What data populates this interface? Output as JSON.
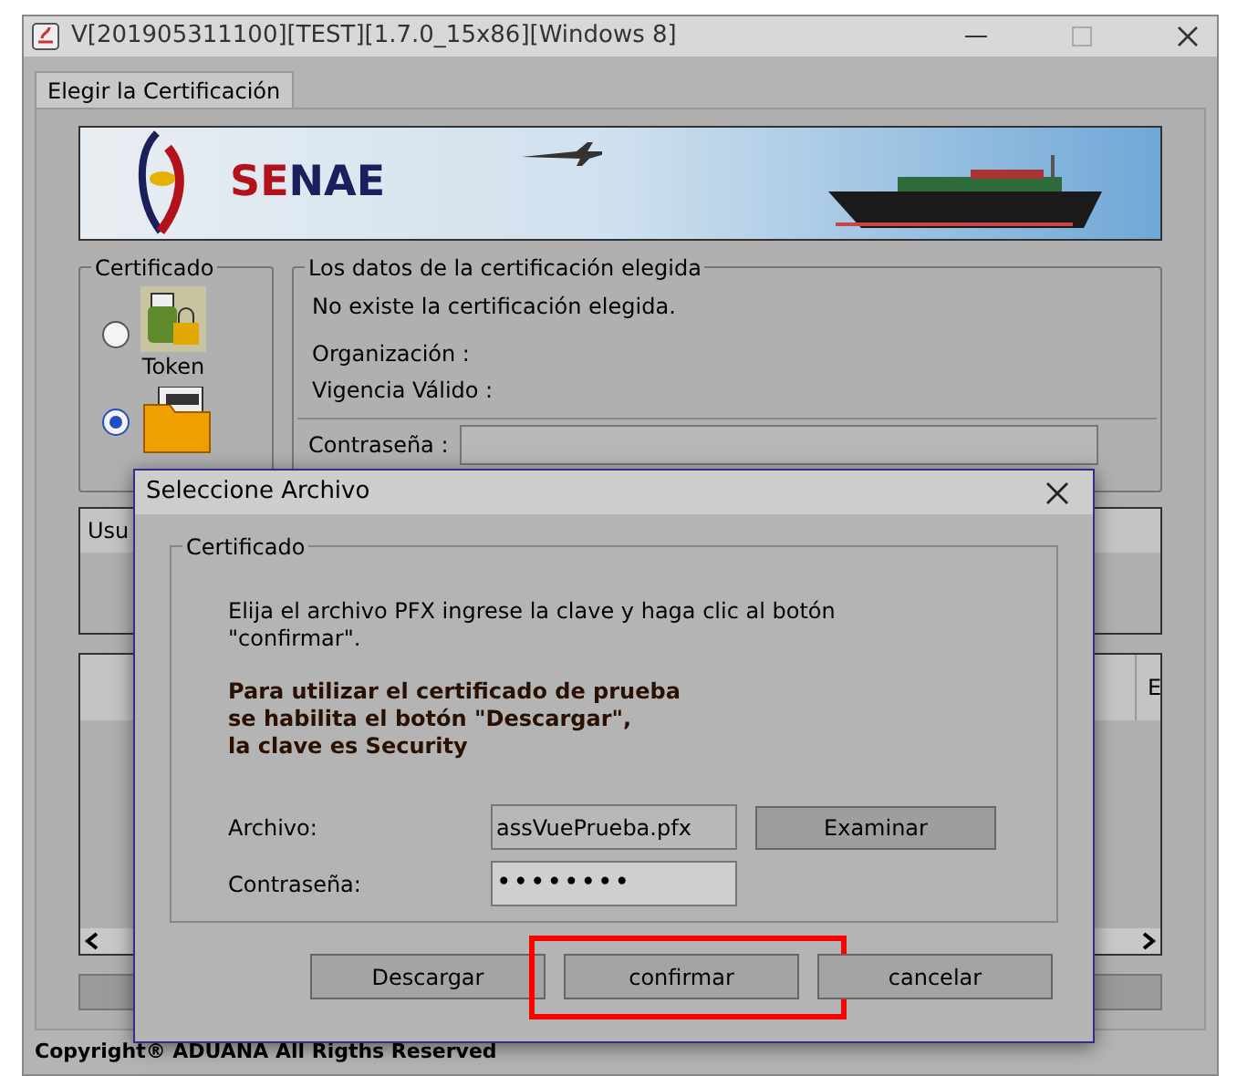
{
  "window": {
    "title": "V[201905311100][TEST][1.7.0_15x86][Windows 8]"
  },
  "tabs": [
    {
      "label": "Elegir la Certificación",
      "selected": true
    }
  ],
  "banner": {
    "logo_parts": [
      {
        "text": "SE",
        "color": "#b3121c"
      },
      {
        "text": "NAE",
        "color": "#1b1f5c"
      }
    ]
  },
  "certificate_group": {
    "title": "Certificado",
    "options": [
      {
        "kind": "token",
        "label": "Token",
        "selected": false
      },
      {
        "kind": "file",
        "selected": true
      }
    ]
  },
  "details_group": {
    "title": "Los datos de la certificación elegida",
    "message": "No existe la certificación elegida.",
    "fields": [
      {
        "label": "Organización :"
      },
      {
        "label": "Vigencia Válido :"
      }
    ],
    "password_label": "Contraseña :"
  },
  "user_panel": {
    "header": "Usu"
  },
  "table": {
    "columns": [
      {
        "label": "E"
      }
    ]
  },
  "dialog": {
    "title": "Seleccione Archivo",
    "group_title": "Certificado",
    "instructions": "Elija el archivo PFX ingrese la clave y haga clic al botón \"confirmar\".",
    "note": "Para utilizar el certificado de prueba\nse habilita el botón \"Descargar\",\nla clave es Security",
    "fields": [
      {
        "kind": "text",
        "label": "Archivo:",
        "value": "assVuePrueba.pfx",
        "button": "Examinar"
      },
      {
        "kind": "password",
        "label": "Contraseña:",
        "value": "••••••••"
      }
    ],
    "buttons": [
      {
        "label": "Descargar",
        "highlighted": false
      },
      {
        "label": "confirmar",
        "highlighted": true
      },
      {
        "label": "cancelar",
        "highlighted": false
      }
    ]
  },
  "footer": "Copyright® ADUANA All Rigths Reserved"
}
